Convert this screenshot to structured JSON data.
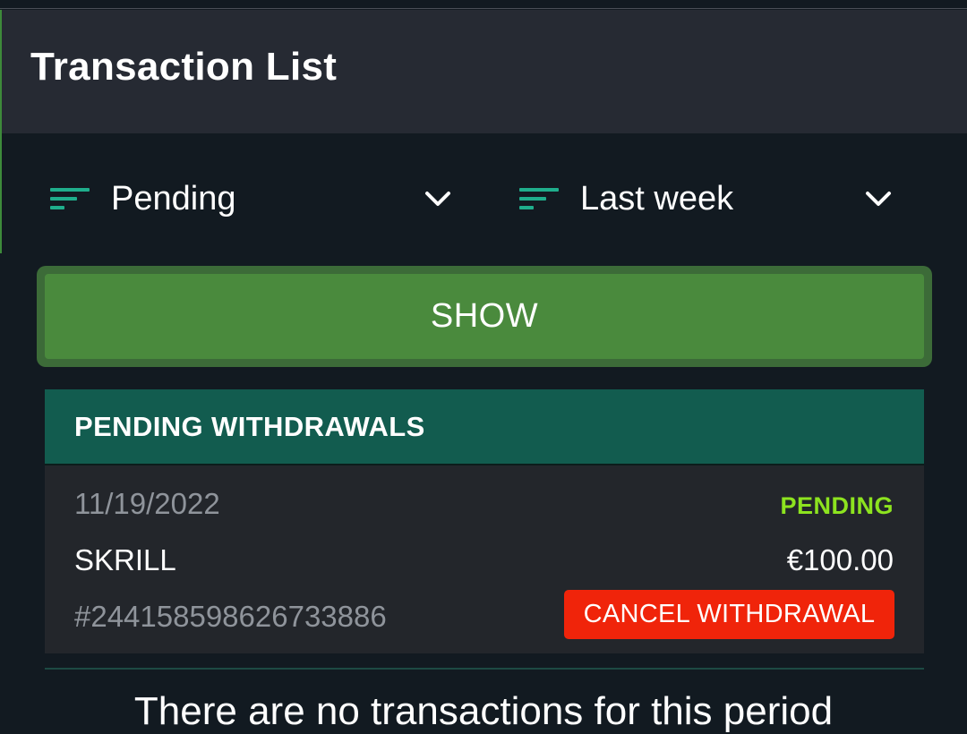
{
  "header": {
    "title": "Transaction List"
  },
  "filters": {
    "status": {
      "value": "Pending",
      "icon": "filter-lines-icon"
    },
    "period": {
      "value": "Last week",
      "icon": "filter-lines-icon"
    }
  },
  "show_button": {
    "label": "SHOW"
  },
  "pending_withdrawals": {
    "heading": "PENDING WITHDRAWALS",
    "items": [
      {
        "date": "11/19/2022",
        "status": "PENDING",
        "method": "SKRILL",
        "amount": "€100.00",
        "id": "#244158598626733886",
        "cancel_label": "CANCEL WITHDRAWAL"
      }
    ]
  },
  "empty_message": "There are no transactions for this period",
  "colors": {
    "accent_teal": "#1fae8c",
    "show_green": "#4a8a3d",
    "header_teal": "#125c4f",
    "pending_lime": "#8de31f",
    "cancel_red": "#f0240a"
  }
}
